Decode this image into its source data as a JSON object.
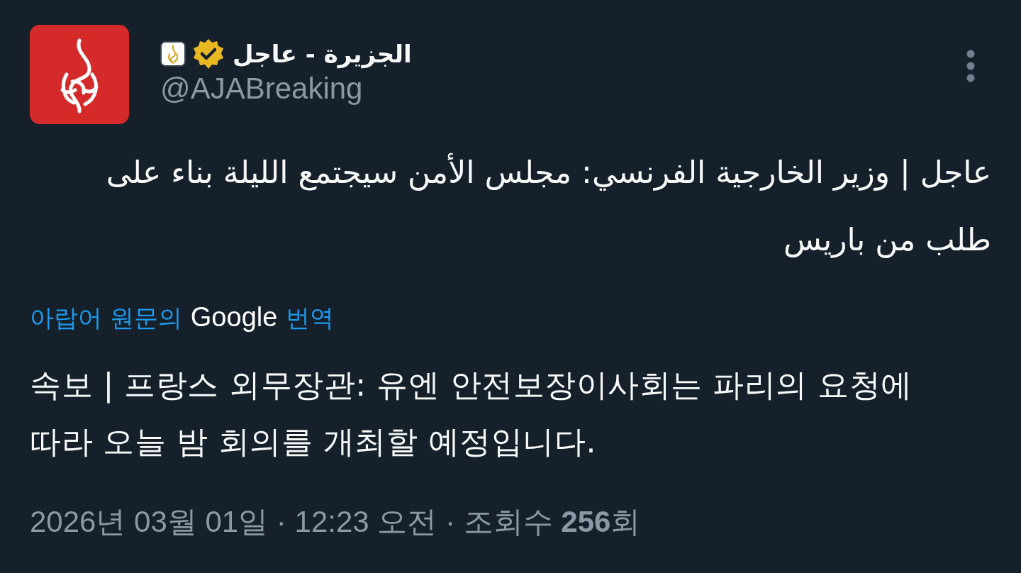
{
  "author": {
    "name": "الجزيرة - عاجل",
    "verified": true,
    "handle": "@AJABreaking"
  },
  "post": {
    "text": "عاجل | وزير الخارجية الفرنسي: مجلس الأمن سيجتمع الليلة بناء على طلب من باريس"
  },
  "translation_link": {
    "before": "아랍어 원문의",
    "brand": "Google",
    "after": "번역"
  },
  "translation": {
    "text": "속보 | 프랑스 외무장관: 유엔 안전보장이사회는 파리의 요청에 따라 오늘 밤 회의를 개최할 예정입니다."
  },
  "meta": {
    "text": "2026년 03월 01일 · 12:23 오전 · 조회수 **256**회"
  }
}
